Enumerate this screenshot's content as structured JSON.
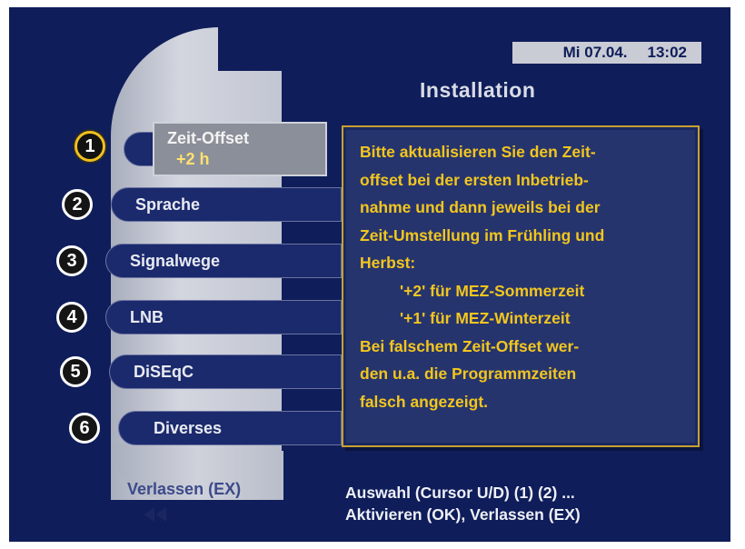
{
  "header": {
    "day": "Mi 07.04.",
    "time": "13:02",
    "title": "Installation"
  },
  "menu": {
    "items": [
      {
        "number": "1",
        "label": "Zeit-Offset",
        "value": "+2  h"
      },
      {
        "number": "2",
        "label": "Sprache"
      },
      {
        "number": "3",
        "label": "Signalwege"
      },
      {
        "number": "4",
        "label": "LNB"
      },
      {
        "number": "5",
        "label": "DiSEqC"
      },
      {
        "number": "6",
        "label": "Diverses"
      }
    ]
  },
  "help": {
    "lines": [
      "Bitte aktualisieren Sie den Zeit-",
      "offset bei der ersten Inbetrieb-",
      "nahme und dann jeweils bei der",
      "Zeit-Umstellung im Frühling und",
      "Herbst:",
      "'+2' für MEZ-Sommerzeit",
      "'+1' für MEZ-Winterzeit",
      "Bei falschem Zeit-Offset wer-",
      "den u.a. die Programmzeiten",
      "falsch angezeigt."
    ]
  },
  "footer": {
    "exit_label": "Verlassen (EX)",
    "hint_line1": "Auswahl (Cursor U/D) (1) (2) ...",
    "hint_line2": "Aktivieren (OK), Verlassen (EX)"
  },
  "colors": {
    "background": "#0f1d5a",
    "help_text": "#f2c61e",
    "active_value": "#ffe070",
    "active_ring": "#f0c020"
  }
}
